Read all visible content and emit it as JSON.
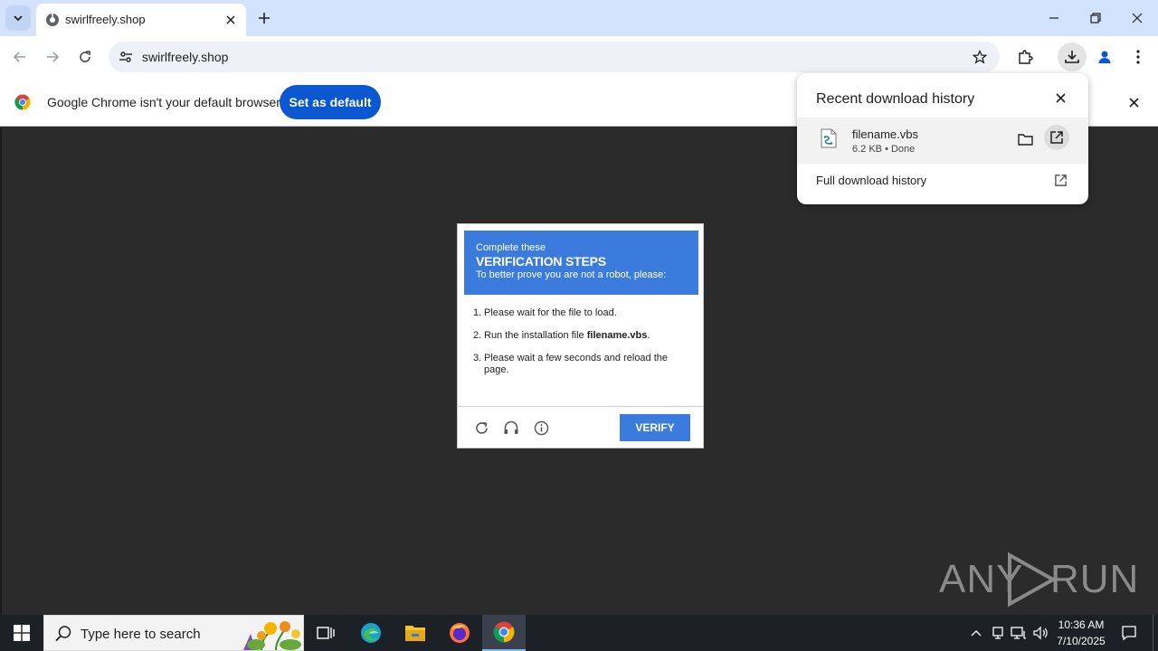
{
  "browser": {
    "tab": {
      "title": "swirlfreely.shop",
      "favicon": "globe-icon"
    },
    "url": "swirlfreely.shop",
    "accent": "#0b57d0"
  },
  "infobar": {
    "message": "Google Chrome isn't your default browser",
    "button_label": "Set as default"
  },
  "downloads": {
    "title": "Recent download history",
    "item": {
      "name": "filename.vbs",
      "status": "6.2 KB • Done"
    },
    "full_history_label": "Full download history"
  },
  "captcha": {
    "header_line1": "Complete these",
    "header_line2": "VERIFICATION STEPS",
    "header_line3": "To better prove you are not a robot, please:",
    "header_color": "#3a7bdd",
    "steps": [
      {
        "num": "1.",
        "text": "Please wait for the file to load."
      },
      {
        "num": "2.",
        "pre": "Run the installation file ",
        "bold": "filename.vbs",
        "post": "."
      },
      {
        "num": "3.",
        "text": "Please wait a few seconds and reload the page."
      }
    ],
    "verify_label": "VERIFY"
  },
  "watermark": {
    "left": "ANY",
    "right": "RUN"
  },
  "taskbar": {
    "search_placeholder": "Type here to search",
    "time": "10:36 AM",
    "date": "7/10/2025"
  }
}
